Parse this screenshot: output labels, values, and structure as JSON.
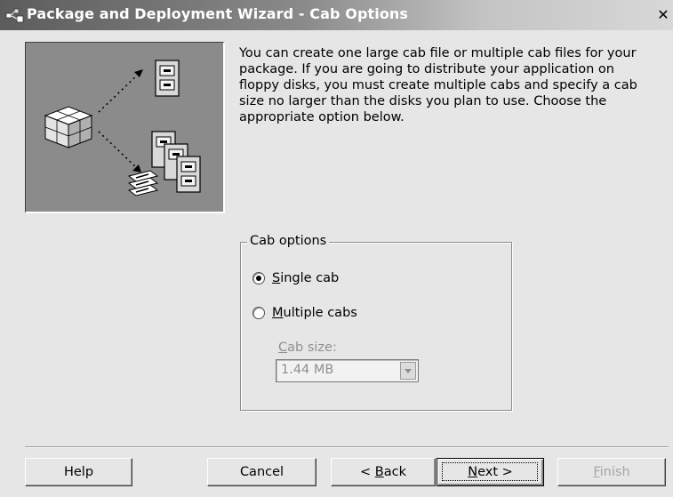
{
  "window": {
    "title": "Package and Deployment Wizard - Cab Options",
    "close_glyph": "✕",
    "icon": "setup-wizard-icon"
  },
  "description": "You can create one large cab file or multiple cab files for your package. If you are going to distribute your application on floppy disks, you must create multiple cabs and specify a cab size no larger than the disks you plan to use. Choose the appropriate option below.",
  "cab_options": {
    "legend": "Cab options",
    "single": {
      "mnemonic": "S",
      "rest": "ingle cab",
      "selected": true
    },
    "multiple": {
      "mnemonic": "M",
      "rest": "ultiple cabs",
      "selected": false
    },
    "cab_size_label": {
      "mnemonic": "C",
      "rest": "ab size:"
    },
    "cab_size_value": "1.44 MB"
  },
  "buttons": {
    "help": "Help",
    "cancel": "Cancel",
    "back_pre": "< ",
    "back_mnemonic": "B",
    "back_rest": "ack",
    "next_mnemonic": "N",
    "next_rest": "ext >",
    "finish_mnemonic": "F",
    "finish_rest": "inish"
  }
}
